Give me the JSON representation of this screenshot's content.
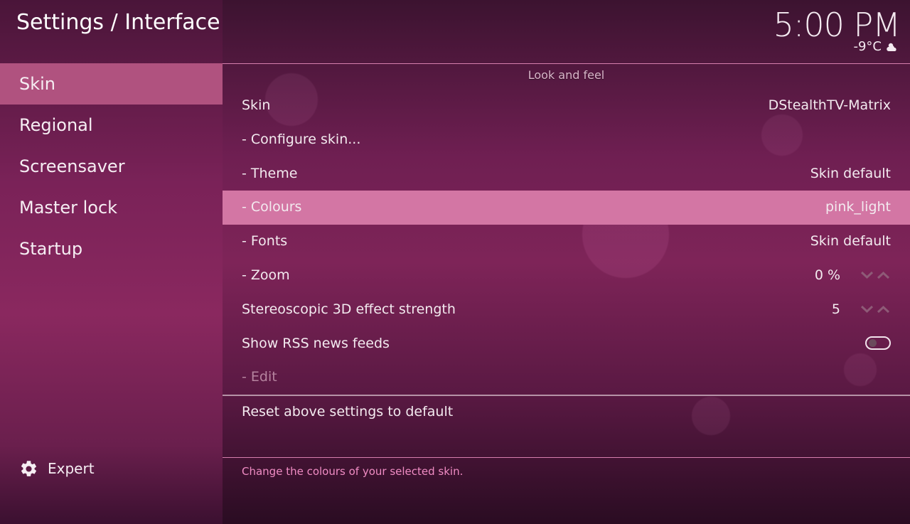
{
  "header": {
    "title": "Settings / Interface",
    "time": "5:00 PM",
    "temperature": "-9°C",
    "weather_icon": "partly-cloudy-icon"
  },
  "sidebar": {
    "items": [
      {
        "label": "Skin",
        "active": true
      },
      {
        "label": "Regional",
        "active": false
      },
      {
        "label": "Screensaver",
        "active": false
      },
      {
        "label": "Master lock",
        "active": false
      },
      {
        "label": "Startup",
        "active": false
      }
    ],
    "expert": {
      "label": "Expert",
      "icon": "gear-icon"
    }
  },
  "main": {
    "section_title": "Look and feel",
    "rows": [
      {
        "label": "Skin",
        "value": "DStealthTV-Matrix"
      },
      {
        "label": "- Configure skin...",
        "value": ""
      },
      {
        "label": "- Theme",
        "value": "Skin default"
      },
      {
        "label": "- Colours",
        "value": "pink_light",
        "selected": true
      },
      {
        "label": "- Fonts",
        "value": "Skin default"
      },
      {
        "label": "- Zoom",
        "value": "0 %"
      },
      {
        "label": "Stereoscopic 3D effect strength",
        "value": "5"
      },
      {
        "label": "Show RSS news feeds",
        "value": "",
        "toggle": "off"
      },
      {
        "label": "- Edit",
        "value": "",
        "disabled": true
      }
    ],
    "reset_label": "Reset above settings to default",
    "help_text": "Change the colours of your selected skin."
  },
  "colors": {
    "accent_selected": "#d376a4",
    "sidebar_active": "#b0527f",
    "help_text": "#f08cc4"
  }
}
